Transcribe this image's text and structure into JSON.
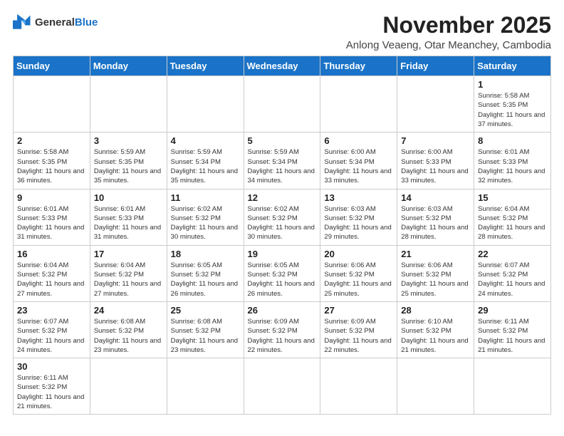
{
  "header": {
    "logo_general": "General",
    "logo_blue": "Blue",
    "month_title": "November 2025",
    "location": "Anlong Veaeng, Otar Meanchey, Cambodia"
  },
  "days_of_week": [
    "Sunday",
    "Monday",
    "Tuesday",
    "Wednesday",
    "Thursday",
    "Friday",
    "Saturday"
  ],
  "weeks": [
    [
      {
        "day": "",
        "info": ""
      },
      {
        "day": "",
        "info": ""
      },
      {
        "day": "",
        "info": ""
      },
      {
        "day": "",
        "info": ""
      },
      {
        "day": "",
        "info": ""
      },
      {
        "day": "",
        "info": ""
      },
      {
        "day": "1",
        "info": "Sunrise: 5:58 AM\nSunset: 5:35 PM\nDaylight: 11 hours\nand 37 minutes."
      }
    ],
    [
      {
        "day": "2",
        "info": "Sunrise: 5:58 AM\nSunset: 5:35 PM\nDaylight: 11 hours\nand 36 minutes."
      },
      {
        "day": "3",
        "info": "Sunrise: 5:59 AM\nSunset: 5:35 PM\nDaylight: 11 hours\nand 35 minutes."
      },
      {
        "day": "4",
        "info": "Sunrise: 5:59 AM\nSunset: 5:34 PM\nDaylight: 11 hours\nand 35 minutes."
      },
      {
        "day": "5",
        "info": "Sunrise: 5:59 AM\nSunset: 5:34 PM\nDaylight: 11 hours\nand 34 minutes."
      },
      {
        "day": "6",
        "info": "Sunrise: 6:00 AM\nSunset: 5:34 PM\nDaylight: 11 hours\nand 33 minutes."
      },
      {
        "day": "7",
        "info": "Sunrise: 6:00 AM\nSunset: 5:33 PM\nDaylight: 11 hours\nand 33 minutes."
      },
      {
        "day": "8",
        "info": "Sunrise: 6:01 AM\nSunset: 5:33 PM\nDaylight: 11 hours\nand 32 minutes."
      }
    ],
    [
      {
        "day": "9",
        "info": "Sunrise: 6:01 AM\nSunset: 5:33 PM\nDaylight: 11 hours\nand 31 minutes."
      },
      {
        "day": "10",
        "info": "Sunrise: 6:01 AM\nSunset: 5:33 PM\nDaylight: 11 hours\nand 31 minutes."
      },
      {
        "day": "11",
        "info": "Sunrise: 6:02 AM\nSunset: 5:32 PM\nDaylight: 11 hours\nand 30 minutes."
      },
      {
        "day": "12",
        "info": "Sunrise: 6:02 AM\nSunset: 5:32 PM\nDaylight: 11 hours\nand 30 minutes."
      },
      {
        "day": "13",
        "info": "Sunrise: 6:03 AM\nSunset: 5:32 PM\nDaylight: 11 hours\nand 29 minutes."
      },
      {
        "day": "14",
        "info": "Sunrise: 6:03 AM\nSunset: 5:32 PM\nDaylight: 11 hours\nand 28 minutes."
      },
      {
        "day": "15",
        "info": "Sunrise: 6:04 AM\nSunset: 5:32 PM\nDaylight: 11 hours\nand 28 minutes."
      }
    ],
    [
      {
        "day": "16",
        "info": "Sunrise: 6:04 AM\nSunset: 5:32 PM\nDaylight: 11 hours\nand 27 minutes."
      },
      {
        "day": "17",
        "info": "Sunrise: 6:04 AM\nSunset: 5:32 PM\nDaylight: 11 hours\nand 27 minutes."
      },
      {
        "day": "18",
        "info": "Sunrise: 6:05 AM\nSunset: 5:32 PM\nDaylight: 11 hours\nand 26 minutes."
      },
      {
        "day": "19",
        "info": "Sunrise: 6:05 AM\nSunset: 5:32 PM\nDaylight: 11 hours\nand 26 minutes."
      },
      {
        "day": "20",
        "info": "Sunrise: 6:06 AM\nSunset: 5:32 PM\nDaylight: 11 hours\nand 25 minutes."
      },
      {
        "day": "21",
        "info": "Sunrise: 6:06 AM\nSunset: 5:32 PM\nDaylight: 11 hours\nand 25 minutes."
      },
      {
        "day": "22",
        "info": "Sunrise: 6:07 AM\nSunset: 5:32 PM\nDaylight: 11 hours\nand 24 minutes."
      }
    ],
    [
      {
        "day": "23",
        "info": "Sunrise: 6:07 AM\nSunset: 5:32 PM\nDaylight: 11 hours\nand 24 minutes."
      },
      {
        "day": "24",
        "info": "Sunrise: 6:08 AM\nSunset: 5:32 PM\nDaylight: 11 hours\nand 23 minutes."
      },
      {
        "day": "25",
        "info": "Sunrise: 6:08 AM\nSunset: 5:32 PM\nDaylight: 11 hours\nand 23 minutes."
      },
      {
        "day": "26",
        "info": "Sunrise: 6:09 AM\nSunset: 5:32 PM\nDaylight: 11 hours\nand 22 minutes."
      },
      {
        "day": "27",
        "info": "Sunrise: 6:09 AM\nSunset: 5:32 PM\nDaylight: 11 hours\nand 22 minutes."
      },
      {
        "day": "28",
        "info": "Sunrise: 6:10 AM\nSunset: 5:32 PM\nDaylight: 11 hours\nand 21 minutes."
      },
      {
        "day": "29",
        "info": "Sunrise: 6:11 AM\nSunset: 5:32 PM\nDaylight: 11 hours\nand 21 minutes."
      }
    ],
    [
      {
        "day": "30",
        "info": "Sunrise: 6:11 AM\nSunset: 5:32 PM\nDaylight: 11 hours\nand 21 minutes."
      },
      {
        "day": "",
        "info": ""
      },
      {
        "day": "",
        "info": ""
      },
      {
        "day": "",
        "info": ""
      },
      {
        "day": "",
        "info": ""
      },
      {
        "day": "",
        "info": ""
      },
      {
        "day": "",
        "info": ""
      }
    ]
  ]
}
